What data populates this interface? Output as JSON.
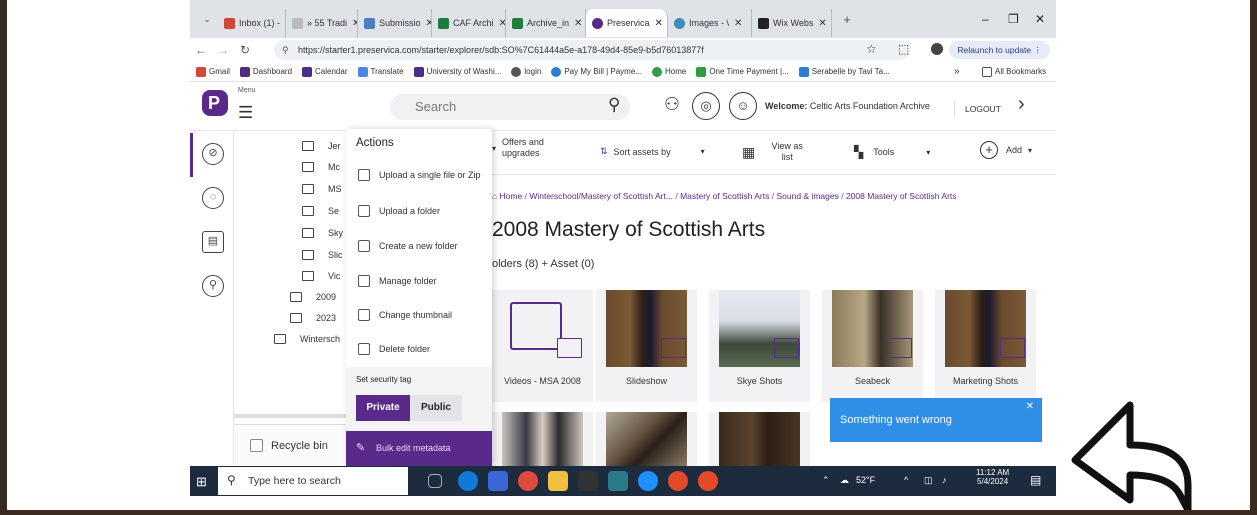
{
  "browser": {
    "tabs": [
      {
        "label": "Inbox (1) -",
        "color": "#d44638"
      },
      {
        "label": "» 55 Tradi",
        "color": "#888888"
      },
      {
        "label": "Submissio",
        "color": "#4a7fc1"
      },
      {
        "label": "CAF Archi",
        "color": "#1e7d3c"
      },
      {
        "label": "Archive_in",
        "color": "#1e7d3c"
      },
      {
        "label": "Preservica",
        "color": "#5a2a8a"
      },
      {
        "label": "Images - \\",
        "color": "#3c8dbc"
      },
      {
        "label": "Wix Webs",
        "color": "#222222"
      }
    ],
    "new_tab": "+",
    "url": "https://starter1.preservica.com/starter/explorer/sdb:SO%7C61444a5e-a178-49d4-85e9-b5d76013877f",
    "relaunch": "Relaunch to update",
    "bookmarks": [
      "Gmail",
      "Dashboard",
      "Calendar",
      "Translate",
      "University of Washi...",
      "login",
      "Pay My Bill | Payme...",
      "Home",
      "One Time Payment |...",
      "Serabelle by Tavi Ta..."
    ],
    "bookmarks_more": "»",
    "all_bookmarks": "All Bookmarks"
  },
  "app": {
    "menu_label": "Menu",
    "search_placeholder": "Search",
    "welcome_prefix": "Welcome:",
    "welcome_name": "Celtic Arts Foundation Archive",
    "logout": "LOGOUT"
  },
  "tree": {
    "items": [
      "Jer",
      "Mc",
      "MS",
      "Se",
      "Sky",
      "Slic",
      "Vic",
      "2009",
      "2023",
      "Wintersch"
    ],
    "recycle": "Recycle bin"
  },
  "actions": {
    "title": "Actions",
    "items": [
      "Upload a single file or Zip",
      "Upload a folder",
      "Create a new folder",
      "Manage folder",
      "Change thumbnail",
      "Delete folder"
    ],
    "security_label": "Set security tag",
    "private": "Private",
    "public": "Public",
    "bulk": "Bulk edit metadata"
  },
  "toolbar": {
    "offers": "Offers and upgrades",
    "sort": "Sort assets by",
    "view": "View as list",
    "tools": "Tools",
    "add": "Add"
  },
  "breadcrumb": {
    "home": "Home",
    "c1": "Winterschool/Mastery of Scottish Art...",
    "c2": "Mastery of Scottish Arts",
    "c3": "Sound & images",
    "current": "2008 Mastery of Scottish Arts"
  },
  "page": {
    "title": "2008 Mastery of Scottish Arts",
    "count": "olders (8) + Asset (0)"
  },
  "cards": [
    "Videos - MSA 2008",
    "Slideshow",
    "Skye Shots",
    "Seabeck",
    "Marketing Shots"
  ],
  "toast": "Something went wrong",
  "taskbar": {
    "search": "Type here to search",
    "weather": "52°F",
    "time": "11:12 AM",
    "date": "5/4/2024"
  }
}
